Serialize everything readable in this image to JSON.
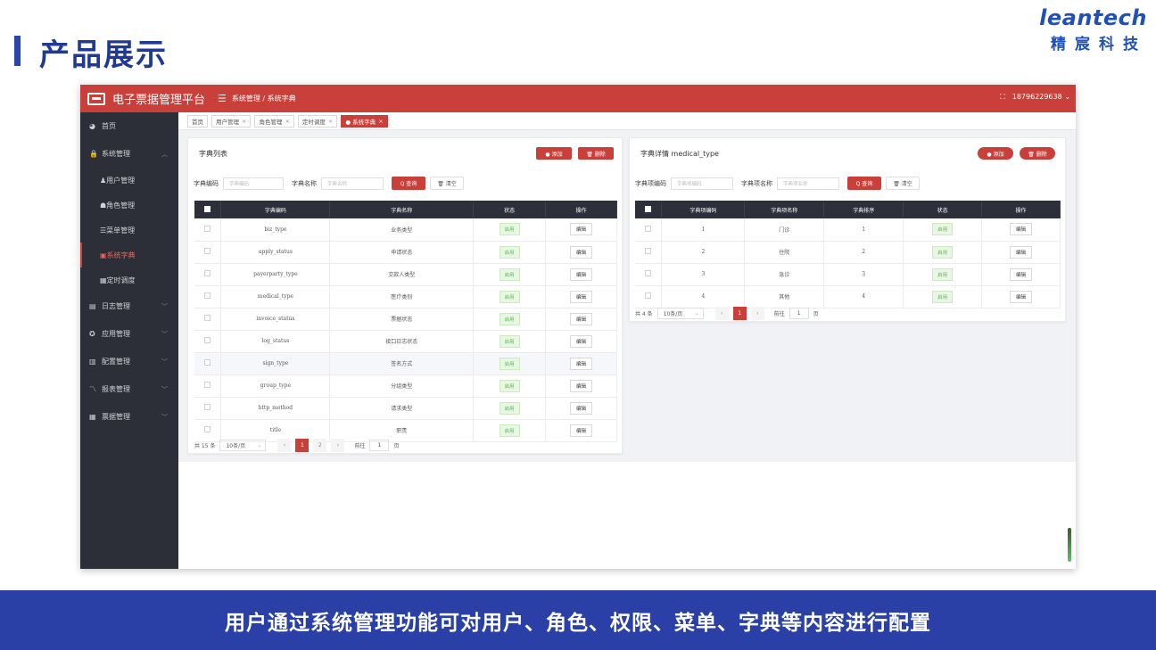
{
  "slide": {
    "title": "产品展示",
    "brand_en": "leantech",
    "brand_cn": "精宸科技",
    "caption": "用户通过系统管理功能可对用户、角色、权限、菜单、字典等内容进行配置",
    "colors": {
      "brand_blue": "#2a40a6",
      "accent_red": "#c9403a",
      "sidebar": "#2d2f38"
    }
  },
  "app": {
    "name": "电子票据管理平台",
    "breadcrumb": "系统管理 / 系统字典",
    "user": "18796229638",
    "sidebar": [
      {
        "label": "首页",
        "icon": "dashboard-icon"
      },
      {
        "label": "系统管理",
        "icon": "lock-icon",
        "expanded": true,
        "children": [
          {
            "label": "用户管理",
            "icon": "user-icon"
          },
          {
            "label": "角色管理",
            "icon": "users-icon"
          },
          {
            "label": "菜单管理",
            "icon": "menu-icon"
          },
          {
            "label": "系统字典",
            "icon": "book-icon",
            "active": true
          },
          {
            "label": "定时调度",
            "icon": "clock-icon"
          }
        ]
      },
      {
        "label": "日志管理",
        "icon": "log-icon"
      },
      {
        "label": "应用管理",
        "icon": "app-icon"
      },
      {
        "label": "配置管理",
        "icon": "config-icon"
      },
      {
        "label": "报表管理",
        "icon": "chart-icon"
      },
      {
        "label": "票据管理",
        "icon": "ticket-icon"
      }
    ],
    "tabs": [
      {
        "label": "首页",
        "closable": false
      },
      {
        "label": "用户管理",
        "closable": true
      },
      {
        "label": "角色管理",
        "closable": true
      },
      {
        "label": "定时调度",
        "closable": true
      },
      {
        "label": "● 系统字典",
        "closable": true,
        "active": true
      }
    ],
    "dict_list": {
      "title": "字典列表",
      "add_label": "● 添加",
      "delete_label": "🗑 删除",
      "code_label": "字典编码",
      "code_placeholder": "字典编码",
      "name_label": "字典名称",
      "name_placeholder": "字典名称",
      "query_label": "Q 查询",
      "clear_label": "🗑 清空",
      "headers": [
        "字典编码",
        "字典名称",
        "状态",
        "操作"
      ],
      "rows": [
        [
          "biz_type",
          "业务类型",
          "启用",
          "编辑"
        ],
        [
          "apply_status",
          "申请状态",
          "启用",
          "编辑"
        ],
        [
          "payerparty_type",
          "交款人类型",
          "启用",
          "编辑"
        ],
        [
          "medical_type",
          "医疗类别",
          "启用",
          "编辑"
        ],
        [
          "invoice_status",
          "票据状态",
          "启用",
          "编辑"
        ],
        [
          "log_status",
          "接口日志状态",
          "启用",
          "编辑"
        ],
        [
          "sign_type",
          "签名方式",
          "启用",
          "编辑"
        ],
        [
          "group_type",
          "分组类型",
          "启用",
          "编辑"
        ],
        [
          "http_method",
          "请求类型",
          "启用",
          "编辑"
        ],
        [
          "title",
          "职责",
          "启用",
          "编辑"
        ]
      ],
      "total": "共 15 条",
      "page_size": "10条/页",
      "pages": [
        "1",
        "2"
      ],
      "goto_label": "前往",
      "goto_value": "1",
      "page_unit": "页"
    },
    "dict_detail": {
      "title": "字典详情 medical_type",
      "add_label": "● 添加",
      "delete_label": "🗑 删除",
      "code_label": "字典项编码",
      "code_placeholder": "字典项编码",
      "name_label": "字典项名称",
      "name_placeholder": "字典项名称",
      "query_label": "Q 查询",
      "clear_label": "🗑 清空",
      "headers": [
        "字典项编码",
        "字典项名称",
        "字典排序",
        "状态",
        "操作"
      ],
      "rows": [
        [
          "1",
          "门诊",
          "1",
          "启用",
          "编辑"
        ],
        [
          "2",
          "住院",
          "2",
          "启用",
          "编辑"
        ],
        [
          "3",
          "急诊",
          "3",
          "启用",
          "编辑"
        ],
        [
          "4",
          "其他",
          "4",
          "启用",
          "编辑"
        ]
      ],
      "total": "共 4 条",
      "page_size": "10条/页",
      "pages": [
        "1"
      ],
      "goto_label": "前往",
      "goto_value": "1",
      "page_unit": "页"
    }
  }
}
